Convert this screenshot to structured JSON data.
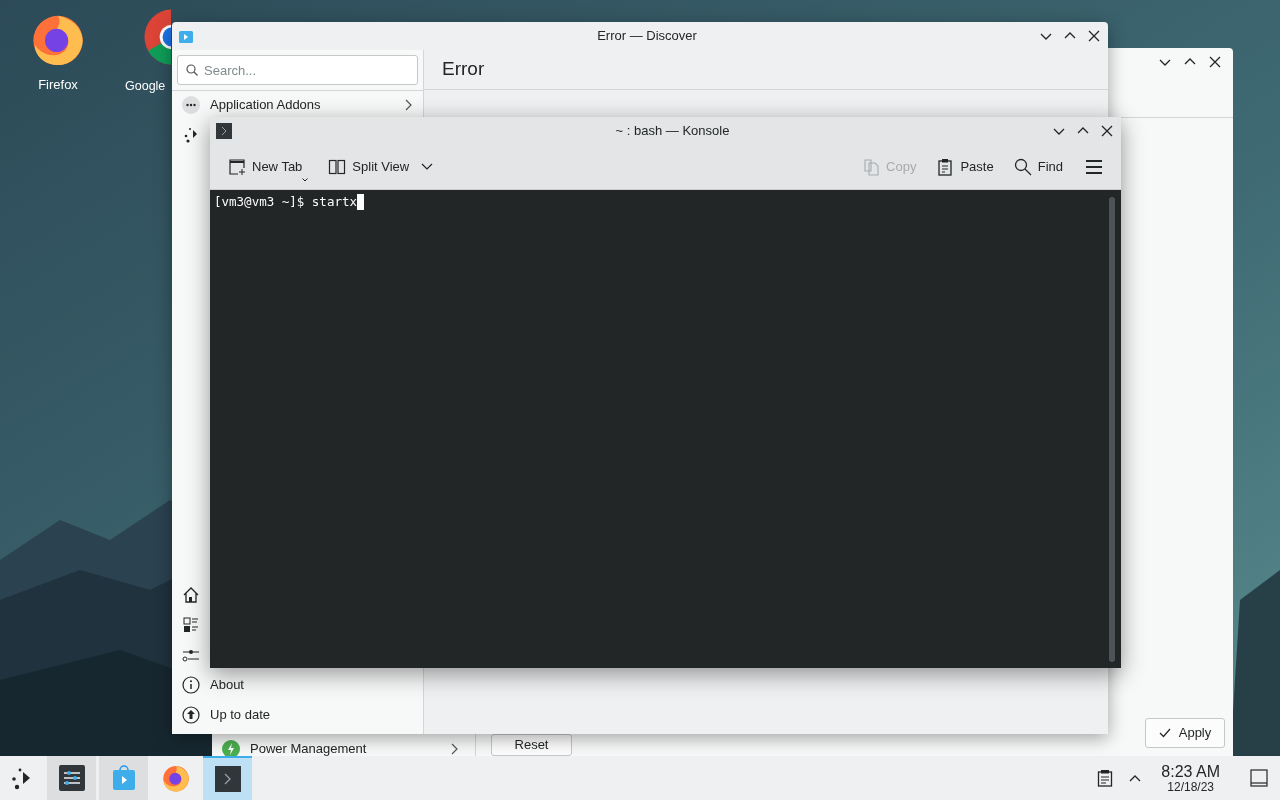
{
  "desktop_icons": [
    {
      "kind": "firefox",
      "label": "Firefox"
    },
    {
      "kind": "chrome",
      "label": "Google"
    }
  ],
  "settings_window": {
    "sidebar_items": [
      {
        "label": "Power Management"
      }
    ],
    "reset_button": "Reset",
    "apply_button": "Apply"
  },
  "discover_window": {
    "title": "Error — Discover",
    "search": {
      "placeholder": "Search..."
    },
    "sidebar_items": [
      {
        "label": "Application Addons"
      }
    ],
    "page_title": "Error",
    "footer_items": [
      {
        "kind": "about",
        "label": "About"
      },
      {
        "kind": "update",
        "label": "Up to date"
      }
    ]
  },
  "konsole_window": {
    "title": "~ : bash — Konsole",
    "toolbar_left": [
      {
        "kind": "newtab",
        "label": "New Tab",
        "disabled": false
      },
      {
        "kind": "split",
        "label": "Split View",
        "disabled": false
      }
    ],
    "toolbar_right": [
      {
        "kind": "copy",
        "label": "Copy",
        "disabled": true
      },
      {
        "kind": "paste",
        "label": "Paste",
        "disabled": false
      },
      {
        "kind": "find",
        "label": "Find",
        "disabled": false
      }
    ],
    "terminal_line": "[vm3@vm3 ~]$ startx"
  },
  "taskbar": {
    "tasks": [
      {
        "kind": "settings",
        "open": true,
        "selected": false
      },
      {
        "kind": "discover",
        "open": true,
        "selected": false
      },
      {
        "kind": "firefox",
        "open": false,
        "selected": false
      },
      {
        "kind": "konsole",
        "open": true,
        "selected": true
      }
    ],
    "time": "8:23 AM",
    "date": "12/18/23"
  }
}
